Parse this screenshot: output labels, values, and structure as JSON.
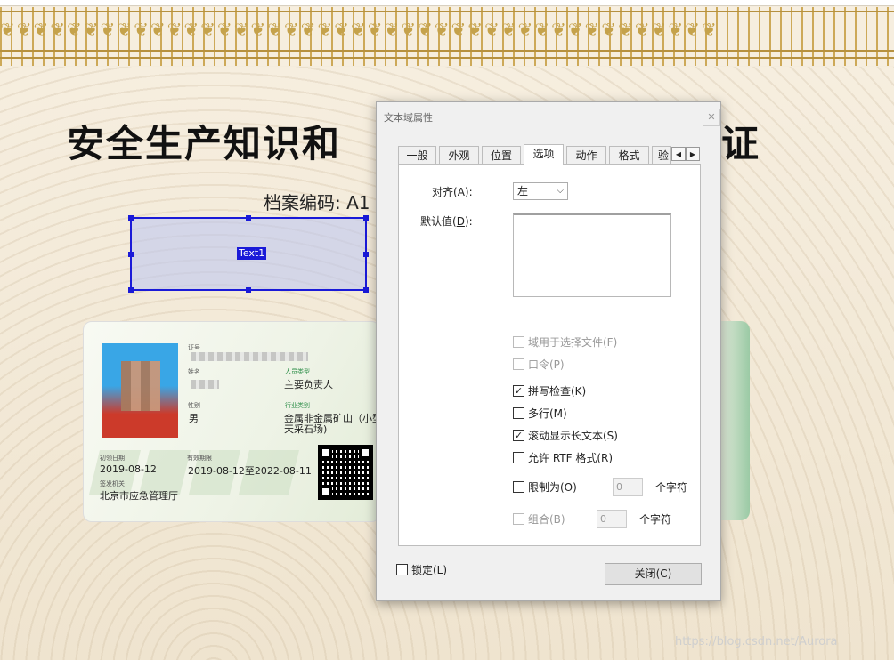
{
  "certificate": {
    "title": "安全生产知识和",
    "title_end": "证",
    "archive_code": "档案编码: A1",
    "field_label": "Text1",
    "ornament": "❦❦❦❦❦❦❦❦❦❦❦❦❦❦❦❦❦❦❦❦❦❦❦❦❦❦❦❦❦❦❦❦❦❦❦❦❦❦❦❦❦❦❦"
  },
  "id_card": {
    "lbl_cert_no": "证号",
    "lbl_name": "姓名",
    "lbl_person_type": "人员类型",
    "person_type": "主要负责人",
    "lbl_gender": "性别",
    "gender": "男",
    "lbl_industry": "行业类别",
    "industry_1": "金属非金属矿山（小型",
    "industry_2": "天采石场)",
    "lbl_first_date": "初领日期",
    "first_date": "2019-08-12",
    "lbl_valid_period": "有效期限",
    "valid_period": "2019-08-12至2022-08-11",
    "lbl_issuer": "签发机关",
    "issuer": "北京市应急管理厅"
  },
  "watermark_text": "https://blog.csdn.net/Aurora",
  "dialog": {
    "title": "文本域属性",
    "close_glyph": "✕",
    "tabs": [
      "一般",
      "外观",
      "位置",
      "选项",
      "动作",
      "格式",
      "验"
    ],
    "active_tab": "选项",
    "tab_prev": "◀",
    "tab_next": "▶",
    "align_label": "对齐(A):",
    "align_label_pre": "对齐(",
    "align_label_key": "A",
    "align_label_post": "):",
    "align_value": "左",
    "default_label_pre": "默认值(",
    "default_label_key": "D",
    "default_label_post": "):",
    "options": [
      {
        "label": "域用于选择文件(F)",
        "checked": false,
        "disabled": true
      },
      {
        "label": "口令(P)",
        "checked": false,
        "disabled": true
      },
      {
        "label": "拼写检查(K)",
        "checked": true,
        "disabled": false
      },
      {
        "label": "多行(M)",
        "checked": false,
        "disabled": false
      },
      {
        "label": "滚动显示长文本(S)",
        "checked": true,
        "disabled": false
      },
      {
        "label": "允许 RTF 格式(R)",
        "checked": false,
        "disabled": false
      }
    ],
    "limit_label": "限制为(O)",
    "limit_value": "0",
    "limit_unit": "个字符",
    "comb_label": "组合(B)",
    "comb_value": "0",
    "comb_unit": "个字符",
    "lock_label": "锁定(L)",
    "close_button": "关闭(C)",
    "check_glyph": "✓"
  }
}
